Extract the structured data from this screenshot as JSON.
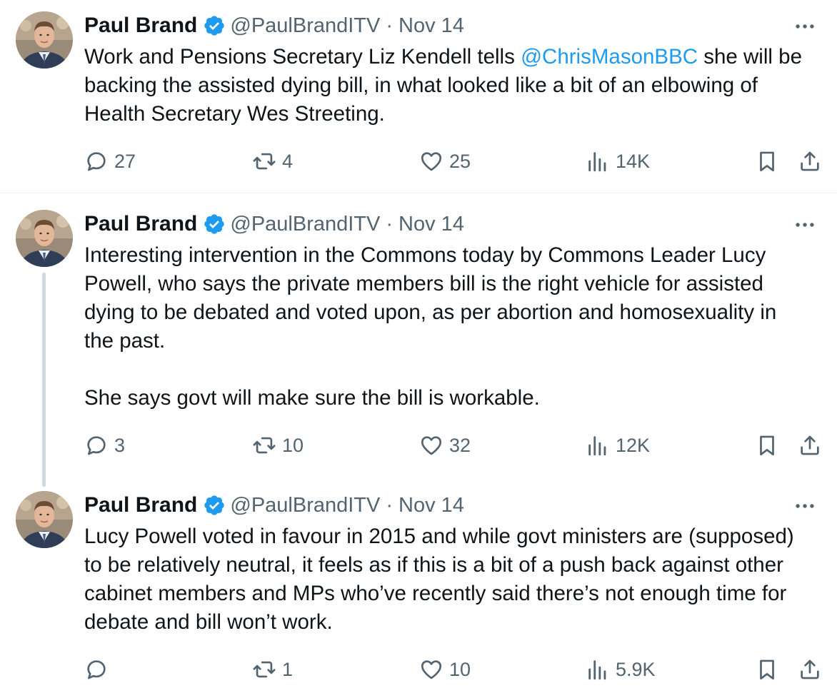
{
  "colors": {
    "accent": "#1d9bf0",
    "secondary_text": "#536471",
    "thread_line": "#cfd9de"
  },
  "tweets": [
    {
      "author_name": "Paul Brand",
      "handle": "@PaulBrandITV",
      "separator": "·",
      "date": "Nov 14",
      "text_pre": "Work and Pensions Secretary Liz Kendell tells ",
      "mention": "@ChrisMasonBBC",
      "text_post": " she will be\nbacking the assisted dying bill, in what looked like a bit of an elbowing of\nHealth Secretary Wes Streeting.",
      "replies": "27",
      "reposts": "4",
      "likes": "25",
      "views": "14K"
    },
    {
      "author_name": "Paul Brand",
      "handle": "@PaulBrandITV",
      "separator": "·",
      "date": "Nov 14",
      "text": "Interesting intervention in the Commons today by Commons Leader Lucy\nPowell, who says the private members bill is the right vehicle for assisted\ndying to be debated and voted upon, as per abortion and homosexuality in\nthe past.\n\nShe says govt will make sure the bill is workable.",
      "replies": "3",
      "reposts": "10",
      "likes": "32",
      "views": "12K"
    },
    {
      "author_name": "Paul Brand",
      "handle": "@PaulBrandITV",
      "separator": "·",
      "date": "Nov 14",
      "text": "Lucy Powell voted in favour in 2015 and while govt ministers are (supposed)\nto be relatively neutral, it feels as if this is a bit of a push back against other\ncabinet members and MPs who’ve recently said there’s not enough time for\ndebate and bill won’t work.",
      "replies": "",
      "reposts": "1",
      "likes": "10",
      "views": "5.9K"
    }
  ],
  "icons": [
    "verified-badge-icon",
    "more-icon",
    "reply-icon",
    "repost-icon",
    "like-icon",
    "views-icon",
    "bookmark-icon",
    "share-icon"
  ]
}
